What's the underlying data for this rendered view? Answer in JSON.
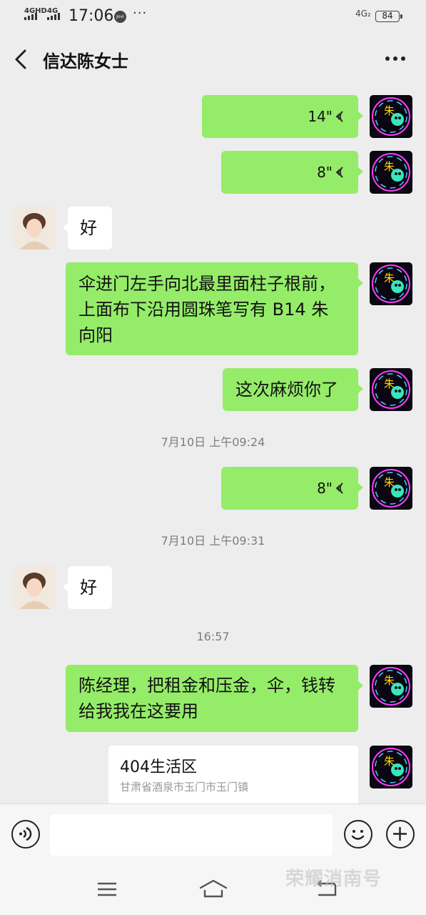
{
  "status_bar": {
    "network1": "4GHD",
    "network2": "4G",
    "time": "17:06",
    "jovi": "Jovi",
    "dots": "···",
    "network3": "4G₂",
    "battery": "84"
  },
  "header": {
    "title": "信达陈女士"
  },
  "messages": [
    {
      "from": "me",
      "type": "voice",
      "duration": "14\""
    },
    {
      "from": "me",
      "type": "voice",
      "duration": "8\""
    },
    {
      "from": "other",
      "type": "text",
      "text": "好"
    },
    {
      "from": "me",
      "type": "text",
      "lines": [
        "伞进门左手向北最里面柱子根前，",
        "上面布下沿用圆珠笔写有 B14 朱",
        "向阳"
      ]
    },
    {
      "from": "me",
      "type": "text",
      "text": "这次麻烦你了"
    },
    {
      "type": "timestamp",
      "text": "7月10日 上午09:24"
    },
    {
      "from": "me",
      "type": "voice",
      "duration": "8\""
    },
    {
      "type": "timestamp",
      "text": "7月10日 上午09:31"
    },
    {
      "from": "other",
      "type": "text",
      "text": "好"
    },
    {
      "type": "timestamp",
      "text": "16:57"
    },
    {
      "from": "me",
      "type": "text",
      "lines": [
        "陈经理，把租金和压金，伞，钱转",
        "给我我在这要用"
      ]
    },
    {
      "from": "me",
      "type": "location",
      "name": "404生活区",
      "address": "甘肃省酒泉市玉门市玉门镇"
    }
  ],
  "avatar_me_char": "朱",
  "input": {
    "placeholder": ""
  },
  "watermark": "荣耀消南号",
  "colors": {
    "bubble_me": "#95ec69",
    "bubble_other": "#ffffff",
    "background": "#ededed"
  },
  "icons": {
    "back": "chevron-left-icon",
    "more": "more-dots-icon",
    "voice_input": "voice-icon",
    "emoji": "emoji-icon",
    "add": "plus-icon"
  }
}
